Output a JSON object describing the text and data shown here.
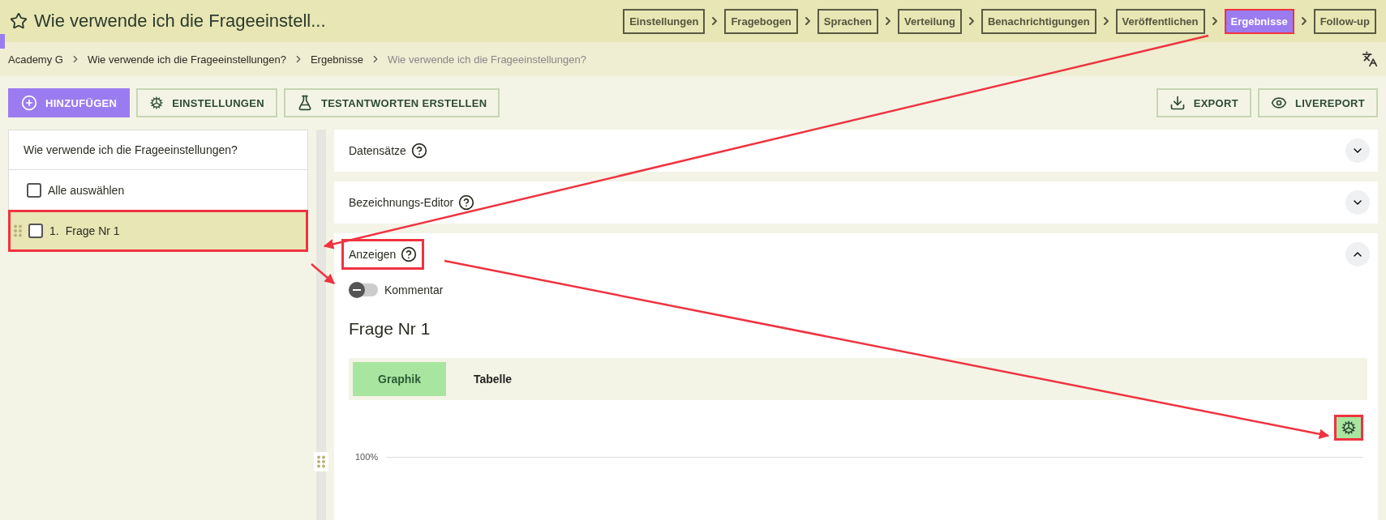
{
  "header": {
    "title": "Wie verwende ich die Frageeinstell...",
    "steps": [
      {
        "label": "Einstellungen",
        "selected": false,
        "highlighted": false
      },
      {
        "label": "Fragebogen",
        "selected": false,
        "highlighted": false
      },
      {
        "label": "Sprachen",
        "selected": false,
        "highlighted": false
      },
      {
        "label": "Verteilung",
        "selected": false,
        "highlighted": false
      },
      {
        "label": "Benachrichtigungen",
        "selected": false,
        "highlighted": false
      },
      {
        "label": "Veröffentlichen",
        "selected": false,
        "highlighted": false
      },
      {
        "label": "Ergebnisse",
        "selected": true,
        "highlighted": true
      },
      {
        "label": "Follow-up",
        "selected": false,
        "highlighted": false
      }
    ]
  },
  "breadcrumb": [
    {
      "label": "Academy G",
      "current": false
    },
    {
      "label": "Wie verwende ich die Frageeinstellungen?",
      "current": false
    },
    {
      "label": "Ergebnisse",
      "current": false
    },
    {
      "label": "Wie verwende ich die Frageeinstellungen?",
      "current": true
    }
  ],
  "toolbar": {
    "left": [
      {
        "label": "HINZUFÜGEN",
        "kind": "add",
        "primary": true
      },
      {
        "label": "EINSTELLUNGEN",
        "kind": "settings",
        "primary": false
      },
      {
        "label": "TESTANTWORTEN ERSTELLEN",
        "kind": "flask",
        "primary": false
      }
    ],
    "right": [
      {
        "label": "EXPORT",
        "kind": "export",
        "primary": false
      },
      {
        "label": "LIVEREPORT",
        "kind": "eye",
        "primary": false
      }
    ]
  },
  "sidebar": {
    "title": "Wie verwende ich die Frageeinstellungen?",
    "select_all": {
      "label": "Alle auswählen",
      "checked": false
    },
    "questions": [
      {
        "number": "1.",
        "label": "Frage Nr 1",
        "checked": false,
        "selected": true,
        "highlighted": true
      }
    ]
  },
  "sections": [
    {
      "title": "Datensätze",
      "expanded": false,
      "highlighted": false
    },
    {
      "title": "Bezeichnungs-Editor",
      "expanded": false,
      "highlighted": false
    },
    {
      "title": "Anzeigen",
      "expanded": true,
      "highlighted": true
    }
  ],
  "display": {
    "toggle": {
      "label": "Kommentar",
      "on": false
    },
    "question_title": "Frage Nr 1",
    "tabs": [
      {
        "label": "Graphik",
        "selected": true
      },
      {
        "label": "Tabelle",
        "selected": false
      }
    ],
    "chart_settings": {
      "highlighted": true
    },
    "chart_tick": "100%"
  }
}
